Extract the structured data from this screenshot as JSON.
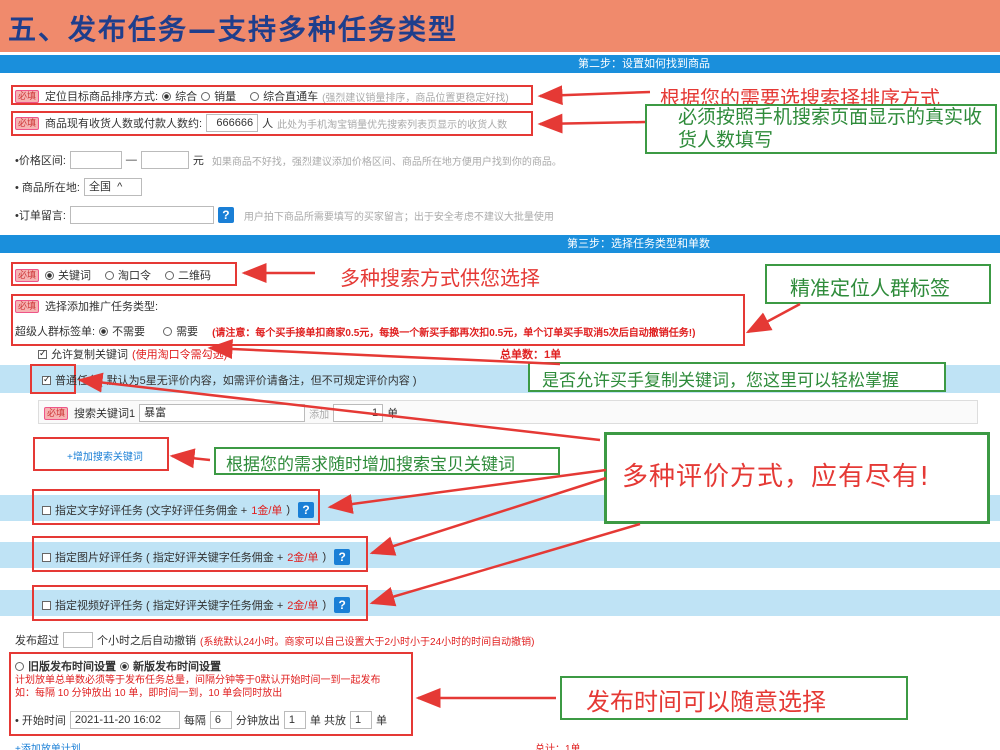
{
  "header": {
    "title": "五、发布任务—支持多种任务类型"
  },
  "step2": {
    "label": "第二步：设置如何找到商品"
  },
  "sort": {
    "tag": "必填",
    "label": "定位目标商品排序方式:",
    "options": [
      "综合",
      "销量",
      "综合直通车"
    ],
    "hint": "(强烈建议销量排序，商品位置更稳定好找)"
  },
  "buyers": {
    "tag": "必填",
    "label": "商品现有收货人数或付款人数约:",
    "value": "666666",
    "unit": "人",
    "hint": "此处为手机淘宝销量优先搜索列表页显示的收货人数"
  },
  "price": {
    "label": "•价格区间:",
    "sep": "—",
    "unit": "元",
    "hint": "如果商品不好找，强烈建议添加价格区间、商品所在地方便用户找到你的商品。"
  },
  "location": {
    "label": "• 商品所在地:",
    "value": "全国",
    "caret": "^"
  },
  "message": {
    "label": "•订单留言:",
    "hint": "用户拍下商品所需要填写的买家留言；出于安全考虑不建议大批量使用"
  },
  "step3": {
    "label": "第三步：选择任务类型和单数"
  },
  "search_type": {
    "tag": "必填",
    "options": [
      "关键词",
      "淘口令",
      "二维码"
    ]
  },
  "promo": {
    "tag": "必填",
    "label": "选择添加推广任务类型:",
    "super_label": "超级人群标签单:",
    "options": [
      "不需要",
      "需要"
    ],
    "note": "(请注意：每个买手接单扣商家0.5元，每换一个新买手都再次扣0.5元，单个订单买手取消5次后自动撤销任务!)"
  },
  "copy_kw": {
    "label": "允许复制关键词",
    "note": "(使用淘口令需勾选)",
    "total": "总单数：1单"
  },
  "normal": {
    "label": "普通任务(",
    "desc": "默认为5星无评价内容，如需评价请备注，但不可规定评价内容 )"
  },
  "keyword": {
    "tag": "必填",
    "label": "搜索关键词1",
    "value": "暴富",
    "add": "添加",
    "count": "1",
    "unit": "单"
  },
  "add_kw": {
    "label": "+增加搜索关键词"
  },
  "reviews": [
    {
      "label": "指定文字好评任务 (文字好评任务佣金 + ",
      "price": "1金/单",
      "end": " )"
    },
    {
      "label": "指定图片好评任务 ( 指定好评关键字任务佣金 + ",
      "price": "2金/单",
      "end": " )"
    },
    {
      "label": "指定视频好评任务 ( 指定好评关键字任务佣金 + ",
      "price": "2金/单",
      "end": " )"
    }
  ],
  "q": "?",
  "cancel": {
    "pre": "发布超过",
    "post": "个小时之后自动撤销",
    "note": "(系统默认24小时。商家可以自己设置大于2小时小于24小时的时间自动撤销)"
  },
  "time": {
    "old": "旧版发布时间设置",
    "new": "新版发布时间设置",
    "desc1": "计划放单总单数必须等于发布任务总量，间隔分钟等于0默认开始时间一到一起发布",
    "desc2": "如：每隔 10 分钟放出 10 单，即时间一到，10 单会同时放出",
    "start_label": "• 开始时间",
    "start_value": "2021-11-20 16:02",
    "every": "每隔",
    "every_value": "6",
    "minutes": "分钟放出",
    "release_value": "1",
    "unit1": "单 共放",
    "total_value": "1",
    "unit2": "单"
  },
  "add_plan": {
    "label": "+添加放单计划",
    "total": "总计：1单"
  },
  "annotations": {
    "a1": "根据您的需要选搜索择排序方式",
    "a2": "必须按照手机搜索页面显示的真实收货人数填写",
    "a3": "多种搜索方式供您选择",
    "a4": "精准定位人群标签",
    "a5": "是否允许买手复制关键词，您这里可以轻松掌握",
    "a6": "根据您的需求随时增加搜索宝贝关键词",
    "a7": "多种评价方式，应有尽有!",
    "a8": "发布时间可以随意选择"
  },
  "colors": {
    "title_bg": "#f08a6c",
    "title_text": "#1f3e8c",
    "step_bar": "#1a8fdc",
    "annotation_red": "#e53935",
    "annotation_green": "#2e8b3a",
    "light_band": "#bfe3f5"
  }
}
